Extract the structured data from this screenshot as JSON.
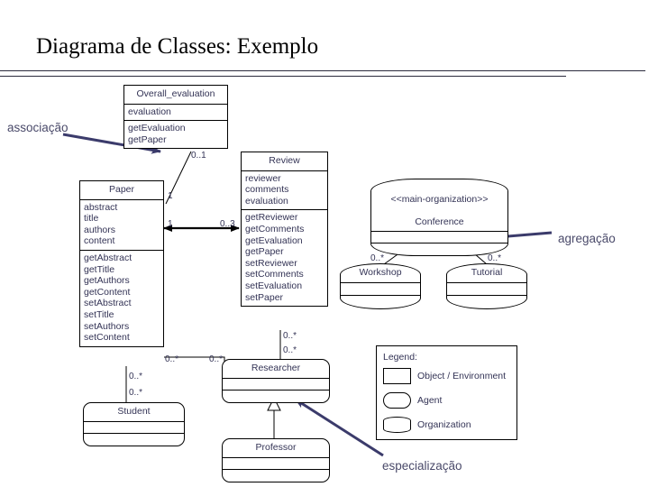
{
  "slide": {
    "title": "Diagrama de Classes: Exemplo"
  },
  "classes": {
    "overall_evaluation": {
      "name": "Overall_evaluation",
      "attributes": "evaluation",
      "operations": "getEvaluation\ngetPaper",
      "shape": "object"
    },
    "paper": {
      "name": "Paper",
      "attributes": "abstract\ntitle\nauthors\ncontent",
      "operations": "getAbstract\ngetTitle\ngetAuthors\ngetContent\nsetAbstract\nsetTitle\nsetAuthors\nsetContent",
      "shape": "object"
    },
    "review": {
      "name": "Review",
      "attributes": "reviewer\ncomments\nevaluation",
      "operations": "getReviewer\ngetComments\ngetEvaluation\ngetPaper\nsetReviewer\nsetComments\nsetEvaluation\nsetPaper",
      "shape": "object"
    },
    "conference": {
      "stereotype": "<<main-organization>>",
      "name": "Conference",
      "attributes": "",
      "operations": "",
      "shape": "organization"
    },
    "workshop": {
      "name": "Workshop",
      "attributes": "",
      "operations": "",
      "shape": "organization"
    },
    "tutorial": {
      "name": "Tutorial",
      "attributes": "",
      "operations": "",
      "shape": "organization"
    },
    "researcher": {
      "name": "Researcher",
      "attributes": "",
      "operations": "",
      "shape": "agent"
    },
    "student": {
      "name": "Student",
      "attributes": "",
      "operations": "",
      "shape": "agent"
    },
    "professor": {
      "name": "Professor",
      "attributes": "",
      "operations": "",
      "shape": "agent"
    }
  },
  "multiplicities": {
    "overall_paper_top": "0..1",
    "overall_paper_bottom": "1",
    "paper_review_left": "1",
    "paper_review_right": "0..3",
    "review_researcher_top": "0..*",
    "review_researcher_bottom": "0..*",
    "paper_researcher_left": "0..*",
    "paper_researcher_right": "0..*",
    "paper_student_top": "0..*",
    "paper_student_bottom": "0..*",
    "conference_workshop": "0..*",
    "conference_tutorial": "0..*"
  },
  "annotations": {
    "associacao": "associação",
    "agregacao": "agregação",
    "especializacao": "especialização"
  },
  "legend": {
    "title": "Legend:",
    "items": [
      {
        "label": "Object / Environment",
        "shape": "object"
      },
      {
        "label": "Agent",
        "shape": "agent"
      },
      {
        "label": "Organization",
        "shape": "organization"
      }
    ]
  },
  "colors": {
    "text": "#333355",
    "line": "#000000",
    "annotation": "#4a4a6a",
    "arrow": "#3b3b6b"
  }
}
